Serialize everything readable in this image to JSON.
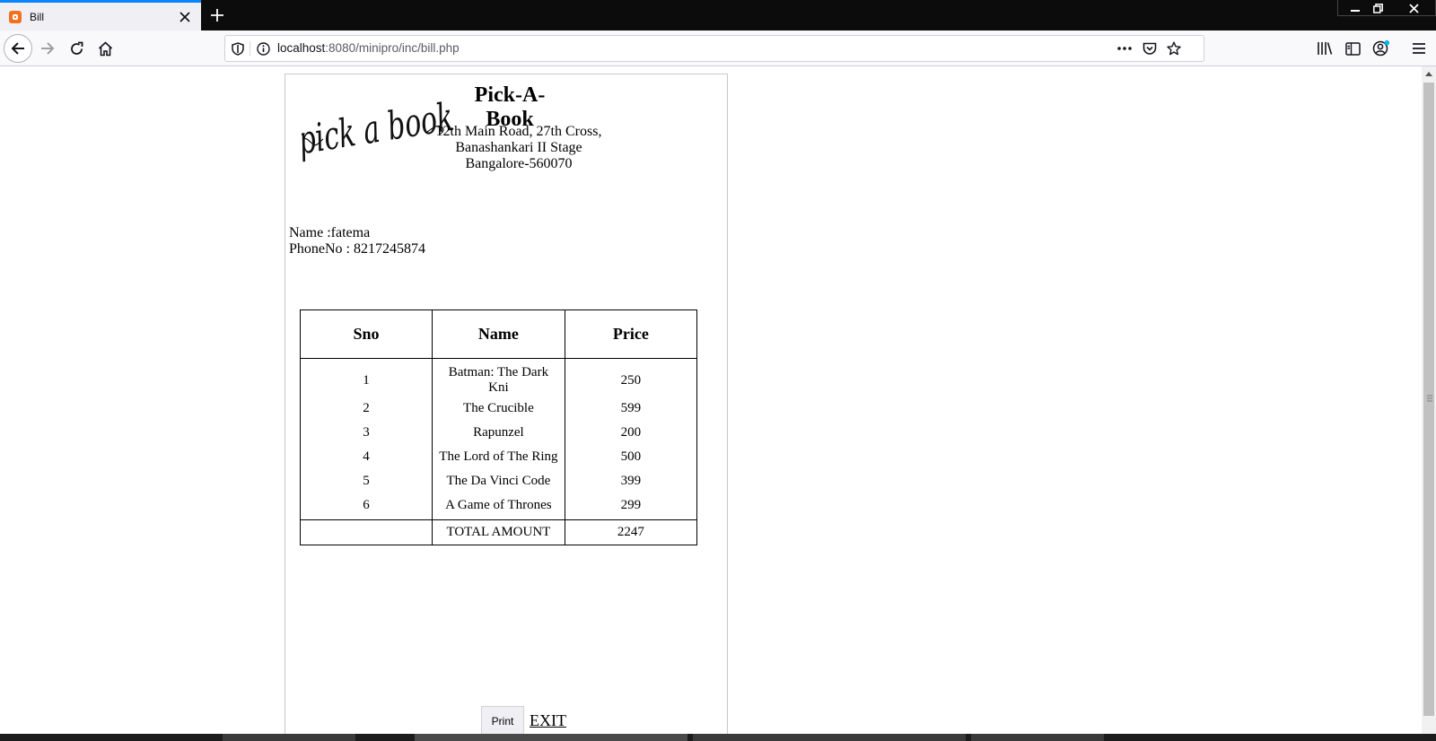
{
  "browser": {
    "tab_title": "Bill",
    "url_host": "localhost",
    "url_path": ":8080/minipro/inc/bill.php"
  },
  "colors": {
    "tab_accent": "#0a84ff",
    "favicon": "#f37021",
    "titlebar": "#0c0c0d",
    "notification_dot": "#00b3f4"
  },
  "icons": [
    "back-icon",
    "forward-icon",
    "reload-icon",
    "home-icon",
    "shield-icon",
    "info-icon",
    "more-icon",
    "pocket-icon",
    "star-icon",
    "library-icon",
    "sidebar-icon",
    "account-icon",
    "menu-icon",
    "close-icon",
    "plus-icon"
  ],
  "bill": {
    "logo_text": "pick a book",
    "shop_name": "Pick-A-Book",
    "address": [
      "12th Main Road, 27th Cross,",
      "Banashankari II Stage",
      "Bangalore-560070"
    ],
    "customer_name": "Name :fatema",
    "customer_phone": "PhoneNo : 8217245874",
    "columns": [
      "Sno",
      "Name",
      "Price"
    ],
    "rows": [
      {
        "sno": "1",
        "name": "Batman: The Dark Kni",
        "price": "250"
      },
      {
        "sno": "2",
        "name": "The Crucible",
        "price": "599"
      },
      {
        "sno": "3",
        "name": "Rapunzel",
        "price": "200"
      },
      {
        "sno": "4",
        "name": "The Lord of The Ring",
        "price": "500"
      },
      {
        "sno": "5",
        "name": "The Da Vinci Code",
        "price": "399"
      },
      {
        "sno": "6",
        "name": "A Game of Thrones",
        "price": "299"
      }
    ],
    "total_label": "TOTAL AMOUNT",
    "total_value": "2247",
    "print_label": "Print",
    "exit_label": "EXIT"
  }
}
